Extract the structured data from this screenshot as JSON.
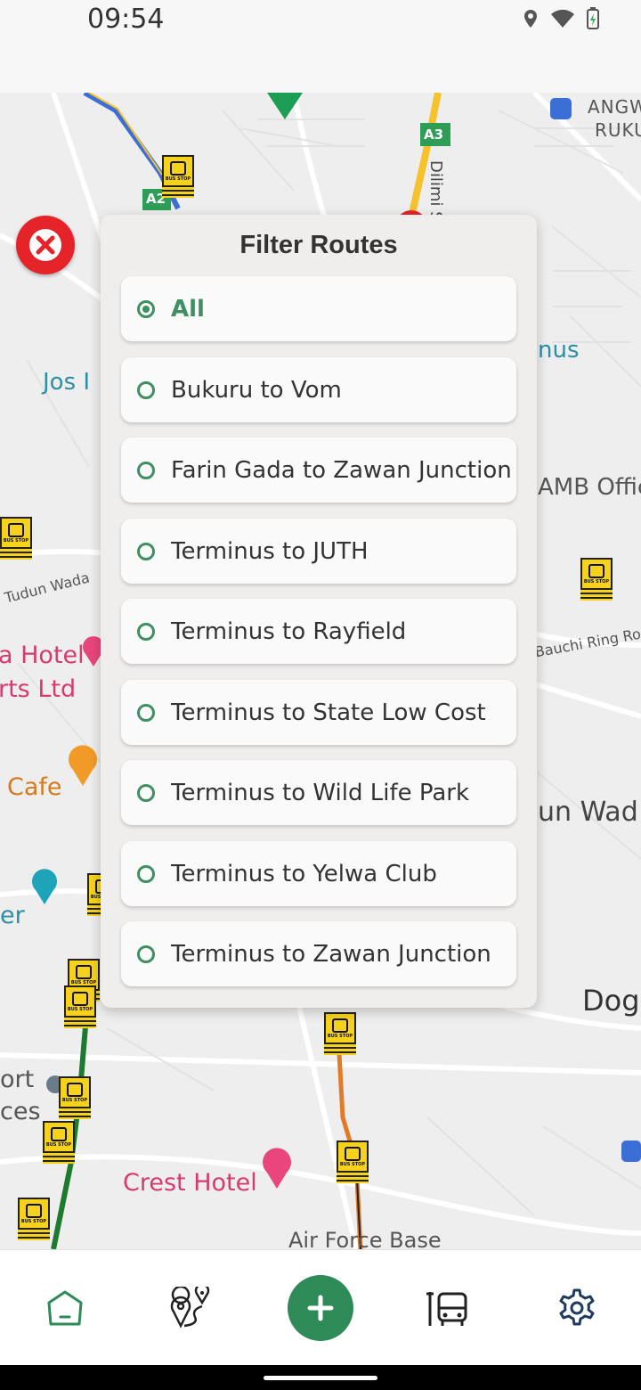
{
  "status_bar": {
    "time": "09:54",
    "icons": [
      "location-icon",
      "wifi-icon",
      "battery-charging-icon"
    ]
  },
  "map": {
    "labels": {
      "jos": "Jos I",
      "angw": "ANGW",
      "ruku": "RUKU",
      "a3": "A3",
      "a2": "A2",
      "dilimi": "Dilimi St",
      "nus": "nus",
      "amb": "AMB Offic",
      "tudun_wada": "Tudun Wada",
      "gauchi_ring": "Bauchi Ring Ro",
      "hotel": "a Hotel",
      "orts": "rts Ltd",
      "cafe": "Cafe",
      "un_wad": "un Wad",
      "er": "er",
      "dog": "Dog",
      "ort": "ort",
      "ces": "ces",
      "crest_hotel": "Crest Hotel",
      "air_force": "Air Force Base",
      "bus_stop": "BUS STOP"
    },
    "route_colors": {
      "blue": "#3b6fd6",
      "orange": "#e07b2a",
      "green": "#1e7a2e",
      "yellow": "#f5c22c"
    }
  },
  "close_button": {
    "icon": "close-icon",
    "color": "#e5242a"
  },
  "dialog": {
    "title": "Filter Routes",
    "options": [
      {
        "label": "All",
        "selected": true
      },
      {
        "label": "Bukuru to Vom",
        "selected": false
      },
      {
        "label": "Farin Gada to Zawan Junction",
        "selected": false
      },
      {
        "label": "Terminus to JUTH",
        "selected": false
      },
      {
        "label": "Terminus to Rayfield",
        "selected": false
      },
      {
        "label": "Terminus to State Low Cost",
        "selected": false
      },
      {
        "label": "Terminus to Wild Life Park",
        "selected": false
      },
      {
        "label": "Terminus to Yelwa Club",
        "selected": false
      },
      {
        "label": "Terminus to Zawan Junction",
        "selected": false
      }
    ],
    "accent": "#3f8f62"
  },
  "bottom_nav": {
    "items": [
      {
        "icon": "home-icon"
      },
      {
        "icon": "route-map-icon"
      },
      {
        "icon": "add-icon"
      },
      {
        "icon": "bus-stop-icon"
      },
      {
        "icon": "settings-icon"
      }
    ],
    "accent": "#2e8b57"
  }
}
